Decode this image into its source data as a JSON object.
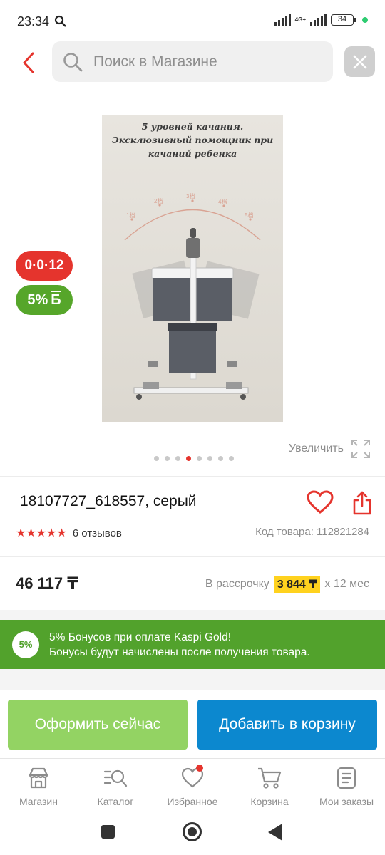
{
  "status_bar": {
    "time": "23:34",
    "network_label": "4G+",
    "battery": "34"
  },
  "search": {
    "placeholder": "Поиск в Магазине"
  },
  "product_image": {
    "caption": "5 уровней качания.\nЭксклюзивный помощник при\nкачаний ребенка",
    "levels": [
      "1档",
      "2档",
      "3档",
      "4档",
      "5档"
    ]
  },
  "badges": {
    "installment": "0·0·12",
    "bonus": "5%"
  },
  "gallery": {
    "zoom_label": "Увеличить",
    "dot_count": 8,
    "active_index": 3
  },
  "product": {
    "title": "18107727_618557, серый",
    "rating_stars": 5,
    "reviews": "6 отзывов",
    "code": "Код товара: 112821284",
    "price": "46 117 ₸",
    "installment_prefix": "В рассрочку",
    "installment_amount": "3 844 ₸",
    "installment_suffix": "x 12 мес"
  },
  "bonus_banner": {
    "percent": "5%",
    "line1": "5% Бонусов при оплате Kaspi Gold!",
    "line2": "Бонусы будут начислены после получения товара."
  },
  "actions": {
    "checkout": "Оформить сейчас",
    "add_to_cart": "Добавить в корзину"
  },
  "bottom_nav": [
    {
      "label": "Магазин",
      "icon": "shop-icon"
    },
    {
      "label": "Каталог",
      "icon": "catalog-search-icon"
    },
    {
      "label": "Избранное",
      "icon": "heart-icon",
      "has_dot": true
    },
    {
      "label": "Корзина",
      "icon": "cart-icon"
    },
    {
      "label": "Мои заказы",
      "icon": "orders-icon"
    }
  ],
  "colors": {
    "accent_red": "#e5342d",
    "green": "#52a22c",
    "checkout_green": "#93d363",
    "cart_blue": "#0c88cf",
    "installment_yellow": "#ffd21e"
  }
}
